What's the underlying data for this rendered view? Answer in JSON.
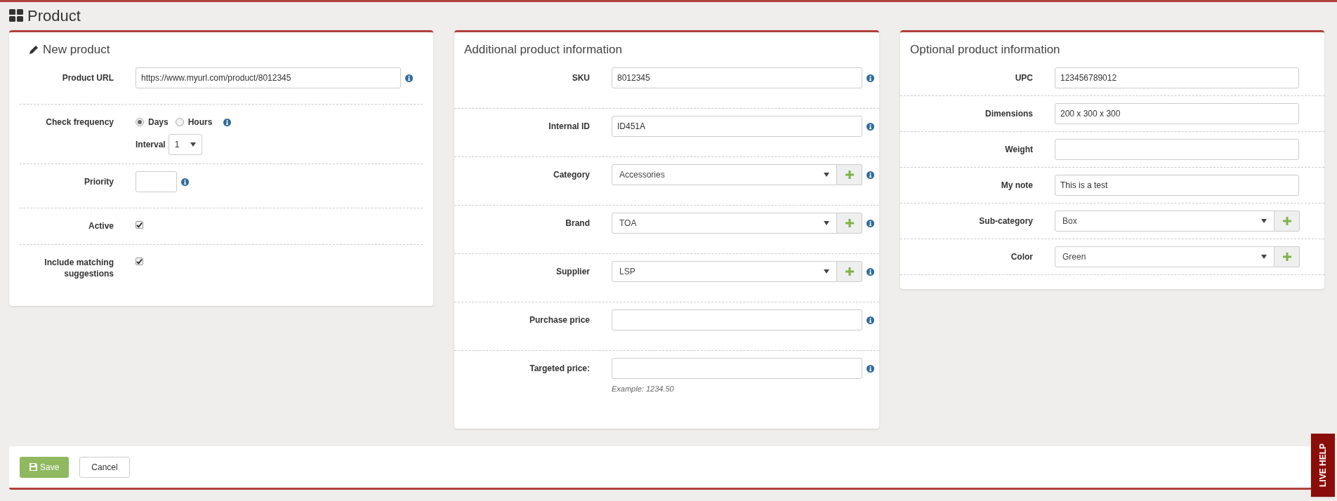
{
  "page_title": "Product",
  "panels": [
    {
      "title": "New product",
      "rows": [
        {
          "kind": "text",
          "label": "Product URL",
          "value": "https://www.myurl.com/product/8012345",
          "info": true
        },
        {
          "kind": "radio",
          "label": "Check frequency",
          "info": true,
          "options": [
            {
              "label": "Days",
              "selected": true
            },
            {
              "label": "Hours",
              "selected": false
            }
          ],
          "interval": {
            "label": "Interval",
            "value": "1"
          }
        },
        {
          "kind": "short",
          "label": "Priority",
          "info": true
        },
        {
          "kind": "checkbox",
          "label": "Active",
          "checked": true
        },
        {
          "kind": "checkbox",
          "label": "Include matching suggestions",
          "checked": true
        }
      ]
    },
    {
      "title": "Additional product information",
      "rows": [
        {
          "kind": "text",
          "label": "SKU",
          "value": "8012345",
          "info": true
        },
        {
          "kind": "text",
          "label": "Internal ID",
          "value": "ID451A",
          "info": true
        },
        {
          "kind": "select",
          "label": "Category",
          "value": "Accessories",
          "info": true
        },
        {
          "kind": "select",
          "label": "Brand",
          "value": "TOA",
          "info": true
        },
        {
          "kind": "select",
          "label": "Supplier",
          "value": "LSP",
          "info": true
        },
        {
          "kind": "text",
          "label": "Purchase price",
          "info": true
        },
        {
          "kind": "text",
          "label": "Targeted price:",
          "info": true,
          "hint": "Example: 1234.50"
        }
      ]
    },
    {
      "title": "Optional product information",
      "rows": [
        {
          "kind": "text",
          "label": "UPC",
          "value": "123456789012",
          "info": false
        },
        {
          "kind": "text",
          "label": "Dimensions",
          "value": "200 x 300 x 300",
          "info": false
        },
        {
          "kind": "text",
          "label": "Weight",
          "info": false
        },
        {
          "kind": "text",
          "label": "My note",
          "value": "This is a test",
          "info": false
        },
        {
          "kind": "select",
          "label": "Sub-category",
          "value": "Box",
          "info": false
        },
        {
          "kind": "select",
          "label": "Color",
          "value": "Green",
          "info": false
        }
      ]
    }
  ],
  "buttons": [
    {
      "label": "Save",
      "kind": "primary"
    },
    {
      "label": "Cancel",
      "kind": "default"
    }
  ],
  "live_help": "LIVE HELP"
}
